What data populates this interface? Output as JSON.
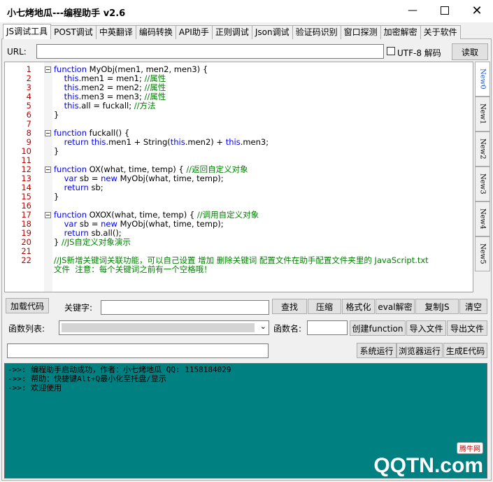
{
  "window": {
    "title": "小七烤地瓜---编程助手 v2.6"
  },
  "tabs": [
    "JS调试工具",
    "POST调试",
    "中英翻译",
    "编码转换",
    "API助手",
    "正则调试",
    "Json调试",
    "验证码识别",
    "窗口探测",
    "加密解密",
    "关于软件"
  ],
  "url_bar": {
    "label": "URL:",
    "value": "",
    "checkbox_label": "UTF-8 解码",
    "checkbox_checked": false,
    "read_button": "读取"
  },
  "editor_lines": [
    {
      "n": "1",
      "fold": true,
      "parts": [
        [
          "kw",
          "function "
        ],
        [
          "",
          "MyObj(men1, men2, men3) {"
        ]
      ]
    },
    {
      "n": "2",
      "parts": [
        [
          "",
          "    "
        ],
        [
          "kw",
          "this"
        ],
        [
          "",
          ".men1 = men1; "
        ],
        [
          "cm",
          "//属性"
        ]
      ]
    },
    {
      "n": "3",
      "parts": [
        [
          "",
          "    "
        ],
        [
          "kw",
          "this"
        ],
        [
          "",
          ".men2 = men2; "
        ],
        [
          "cm",
          "//属性"
        ]
      ]
    },
    {
      "n": "4",
      "parts": [
        [
          "",
          "    "
        ],
        [
          "kw",
          "this"
        ],
        [
          "",
          ".men3 = men3; "
        ],
        [
          "cm",
          "//属性"
        ]
      ]
    },
    {
      "n": "5",
      "parts": [
        [
          "",
          "    "
        ],
        [
          "kw",
          "this"
        ],
        [
          "",
          ".all = fuckall; "
        ],
        [
          "cm",
          "//方法"
        ]
      ]
    },
    {
      "n": "6",
      "parts": [
        [
          "",
          "}"
        ]
      ]
    },
    {
      "n": "7",
      "parts": []
    },
    {
      "n": "8",
      "fold": true,
      "parts": [
        [
          "kw",
          "function "
        ],
        [
          "",
          "fuckall() {"
        ]
      ]
    },
    {
      "n": "9",
      "parts": [
        [
          "",
          "    "
        ],
        [
          "kw",
          "return this"
        ],
        [
          "",
          ".men1 + String("
        ],
        [
          "kw",
          "this"
        ],
        [
          "",
          ".men2) + "
        ],
        [
          "kw",
          "this"
        ],
        [
          "",
          ".men3;"
        ]
      ]
    },
    {
      "n": "10",
      "parts": [
        [
          "",
          "}"
        ]
      ]
    },
    {
      "n": "11",
      "parts": []
    },
    {
      "n": "12",
      "fold": true,
      "parts": [
        [
          "kw",
          "function "
        ],
        [
          "",
          "OX(what, time, temp) { "
        ],
        [
          "cm",
          "//返回自定义对象"
        ]
      ]
    },
    {
      "n": "13",
      "parts": [
        [
          "",
          "    "
        ],
        [
          "kw",
          "var "
        ],
        [
          "",
          "sb = "
        ],
        [
          "kw",
          "new "
        ],
        [
          "",
          "MyObj(what, time, temp);"
        ]
      ]
    },
    {
      "n": "14",
      "parts": [
        [
          "",
          "    "
        ],
        [
          "kw",
          "return "
        ],
        [
          "",
          "sb;"
        ]
      ]
    },
    {
      "n": "15",
      "parts": [
        [
          "",
          "}"
        ]
      ]
    },
    {
      "n": "16",
      "parts": []
    },
    {
      "n": "17",
      "fold": true,
      "parts": [
        [
          "kw",
          "function "
        ],
        [
          "",
          "OXOX(what, time, temp) { "
        ],
        [
          "cm",
          "//调用自定义对象"
        ]
      ]
    },
    {
      "n": "18",
      "parts": [
        [
          "",
          "    "
        ],
        [
          "kw",
          "var "
        ],
        [
          "",
          "sb = "
        ],
        [
          "kw",
          "new "
        ],
        [
          "",
          "MyObj(what, time, temp);"
        ]
      ]
    },
    {
      "n": "19",
      "parts": [
        [
          "",
          "    "
        ],
        [
          "kw",
          "return "
        ],
        [
          "",
          "sb.all();"
        ]
      ]
    },
    {
      "n": "20",
      "parts": [
        [
          "",
          "} "
        ],
        [
          "cm",
          "//JS自定义对象演示"
        ]
      ]
    },
    {
      "n": "21",
      "parts": []
    },
    {
      "n": "22",
      "parts": [
        [
          "cm",
          "//JS新增关键词关联功能，可以自己设置 增加 删除关键词 配置文件在助手配置文件夹里的 JavaScript.txt"
        ]
      ]
    },
    {
      "n": "",
      "parts": [
        [
          "cm",
          "文件  注意：每个关键词之前有一个空格哦！"
        ]
      ]
    }
  ],
  "side_tabs": [
    "New0",
    "New1",
    "New2",
    "New3",
    "New4",
    "New5"
  ],
  "row1": {
    "load_button": "加载代码",
    "keyword_label": "关键字:",
    "keyword_value": "",
    "buttons": [
      "查找",
      "压缩",
      "格式化",
      "eval解密",
      "复制JS",
      "清空"
    ]
  },
  "row2": {
    "func_list_label": "函数列表:",
    "func_list_value": "",
    "func_name_label": "函数名:",
    "func_name_value": "",
    "buttons": [
      "创建function",
      "导入文件",
      "导出文件"
    ]
  },
  "row3": {
    "input_value": "",
    "buttons": [
      "系统运行",
      "浏览器运行",
      "生成E代码"
    ]
  },
  "console_lines": [
    "->>: 编程助手启动成功，作者：小七烤地瓜  QQ: 1158184029",
    "->>: 帮助：快捷键Alt+Q最小化至托盘/显示",
    "->>: 欢迎使用"
  ],
  "watermark": {
    "badge": "腾牛网",
    "text": "QQTN.com"
  },
  "colors": {
    "console_bg": "#008080",
    "keyword": "#0000ff",
    "comment": "#008000",
    "line_number": "#c00000"
  }
}
